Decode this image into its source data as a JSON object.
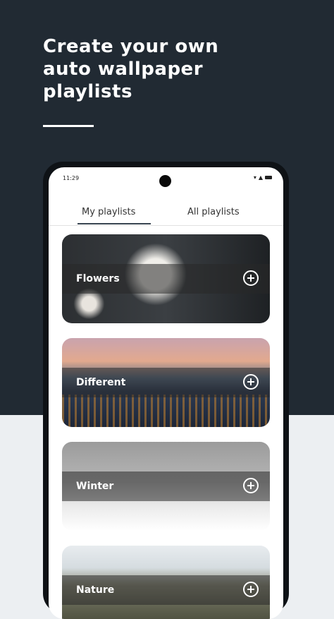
{
  "headline": {
    "line1": "Create your own",
    "line2": "auto wallpaper",
    "line3": "playlists"
  },
  "status_bar": {
    "time": "11:29",
    "icons": [
      "wifi-icon",
      "signal-icon",
      "battery-icon"
    ]
  },
  "tabs": [
    {
      "label": "My playlists",
      "selected": true
    },
    {
      "label": "All playlists",
      "selected": false
    }
  ],
  "playlists": [
    {
      "label": "Flowers",
      "action_icon": "add-circle-icon"
    },
    {
      "label": "Different",
      "action_icon": "add-circle-icon"
    },
    {
      "label": "Winter",
      "action_icon": "add-circle-icon"
    },
    {
      "label": "Nature",
      "action_icon": "add-circle-icon"
    }
  ],
  "colors": {
    "dark_header": "#212A33",
    "light_bg": "#ECEFF2",
    "accent": "#3A4652"
  }
}
